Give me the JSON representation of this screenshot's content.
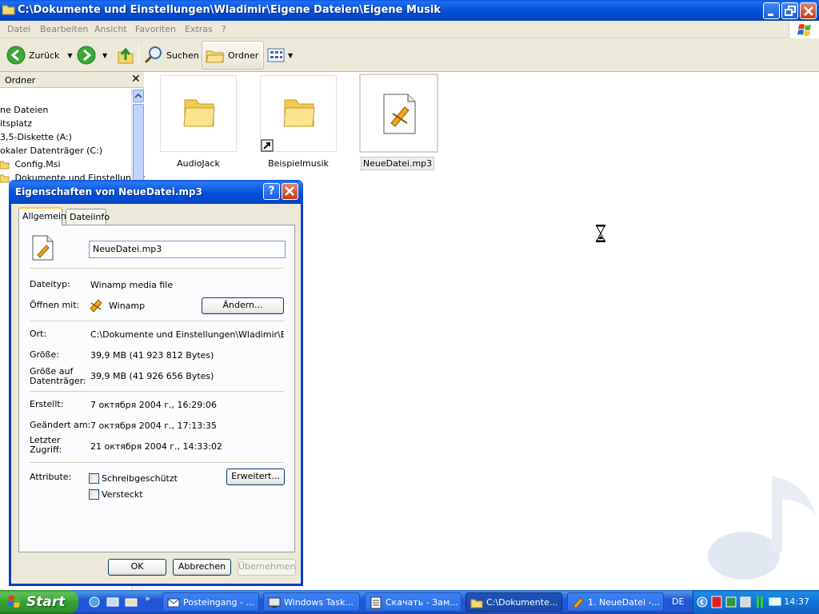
{
  "window": {
    "title": "C:\\Dokumente und Einstellungen\\Wladimir\\Eigene Dateien\\Eigene Musik"
  },
  "menu": [
    "Datei",
    "Bearbeiten",
    "Ansicht",
    "Favoriten",
    "Extras",
    "?"
  ],
  "toolbar": {
    "back": "Zurück",
    "search": "Suchen",
    "folders": "Ordner"
  },
  "folder_pane": {
    "title": "Ordner",
    "items": [
      "ne Dateien",
      "itsplatz",
      "3,5-Diskette (A:)",
      "okaler Datenträger (C:)",
      "Config.Msi",
      "Dokumente und Einstellungen"
    ]
  },
  "files": [
    {
      "name": "AudioJack"
    },
    {
      "name": "Beispielmusik"
    },
    {
      "name": "NeueDatei.mp3"
    }
  ],
  "dialog": {
    "title": "Eigenschaften von NeueDatei.mp3",
    "tabs": [
      "Allgemein",
      "Dateiinfo"
    ],
    "filename": "NeueDatei.mp3",
    "filetype_label": "Dateityp:",
    "filetype": "Winamp media file",
    "openwith_label": "Öffnen mit:",
    "openwith": "Winamp",
    "change_button": "Ändern...",
    "location_label": "Ort:",
    "location": "C:\\Dokumente und Einstellungen\\Wladimir\\Eigene I",
    "size_label": "Größe:",
    "size": "39,9 MB (41 923 812 Bytes)",
    "sizeondisk_label1": "Größe auf",
    "sizeondisk_label2": "Datenträger:",
    "sizeondisk": "39,9 MB (41 926 656 Bytes)",
    "created_label": "Erstellt:",
    "created": "7 октября 2004 г., 16:29:06",
    "modified_label": "Geändert am:",
    "modified": "7 октября 2004 г., 17:13:35",
    "accessed_label1": "Letzter",
    "accessed_label2": "Zugriff:",
    "accessed": "21 октября 2004 г., 14:33:02",
    "attributes_label": "Attribute:",
    "readonly": "Schreibgeschützt",
    "hidden": "Versteckt",
    "advanced_button": "Erweitert...",
    "ok": "OK",
    "cancel": "Abbrechen",
    "apply": "Übernehmen"
  },
  "taskbar": {
    "start": "Start",
    "tasks": [
      "Posteingang - ...",
      "Windows Task...",
      "Скачать - Зам...",
      "C:\\Dokumente...",
      "1. NeueDatei -..."
    ],
    "language": "DE",
    "clock": "14:37"
  }
}
